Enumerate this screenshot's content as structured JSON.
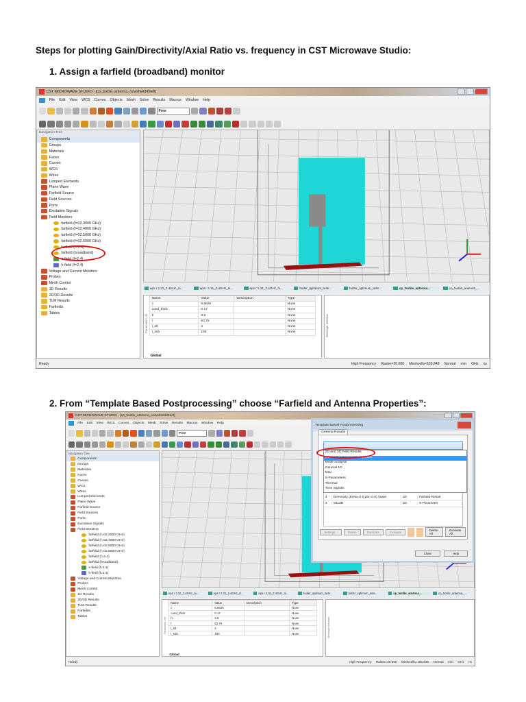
{
  "document": {
    "heading": "Steps for plotting Gain/Directivity/Axial Ratio vs. frequency in CST Microwave Studio:",
    "step1": "1.   Assign a farfield (broadband) monitor",
    "step2": "2.   From “Template Based Postprocessing” choose “Farfield and Antenna Properties”:"
  },
  "app": {
    "title": "CST MICROWAVE STUDIO - [cp_textile_antenna_newshield45left]",
    "menu": [
      "File",
      "Edit",
      "View",
      "WCS",
      "Curves",
      "Objects",
      "Mesh",
      "Solve",
      "Results",
      "Macros",
      "Window",
      "Help"
    ],
    "toolbar_select": "Free",
    "nav_title": "Navigation Tree",
    "nav": [
      {
        "label": "Components",
        "lvl": 0,
        "ic": "folder"
      },
      {
        "label": "Groups",
        "lvl": 0,
        "ic": "folder"
      },
      {
        "label": "Materials",
        "lvl": 0,
        "ic": "folder"
      },
      {
        "label": "Faces",
        "lvl": 0,
        "ic": "folder"
      },
      {
        "label": "Curves",
        "lvl": 0,
        "ic": "folder"
      },
      {
        "label": "WCS",
        "lvl": 0,
        "ic": "folder"
      },
      {
        "label": "Wires",
        "lvl": 0,
        "ic": "folder"
      },
      {
        "label": "Lumped Elements",
        "lvl": 0,
        "ic": "red"
      },
      {
        "label": "Plane Wave",
        "lvl": 0,
        "ic": "red"
      },
      {
        "label": "Farfield Source",
        "lvl": 0,
        "ic": "red"
      },
      {
        "label": "Field Sources",
        "lvl": 0,
        "ic": "red"
      },
      {
        "label": "Ports",
        "lvl": 0,
        "ic": "red"
      },
      {
        "label": "Excitation Signals",
        "lvl": 0,
        "ic": "red"
      },
      {
        "label": "Field Monitors",
        "lvl": 0,
        "ic": "red"
      },
      {
        "label": "farfield (f=02.3000 GHz)",
        "lvl": 1,
        "ic": "ff"
      },
      {
        "label": "farfield (f=02.4000 GHz)",
        "lvl": 1,
        "ic": "ff"
      },
      {
        "label": "farfield (f=02.5000 GHz)",
        "lvl": 1,
        "ic": "ff"
      },
      {
        "label": "farfield (f=02.6000 GHz)",
        "lvl": 1,
        "ic": "ff"
      },
      {
        "label": "farfield (f=2.4)",
        "lvl": 1,
        "ic": "ff"
      },
      {
        "label": "farfield (broadband)",
        "lvl": 1,
        "ic": "ff"
      },
      {
        "label": "e-field (f=2.4)",
        "lvl": 1,
        "ic": "ef"
      },
      {
        "label": "h-field (f=2.4)",
        "lvl": 1,
        "ic": "hf"
      },
      {
        "label": "Voltage and Current Monitors",
        "lvl": 0,
        "ic": "red"
      },
      {
        "label": "Probes",
        "lvl": 0,
        "ic": "red"
      },
      {
        "label": "Mesh Control",
        "lvl": 0,
        "ic": "red"
      },
      {
        "label": "1D Results",
        "lvl": 0,
        "ic": "folder"
      },
      {
        "label": "2D/3D Results",
        "lvl": 0,
        "ic": "folder"
      },
      {
        "label": "TLM Results",
        "lvl": 0,
        "ic": "folder"
      },
      {
        "label": "Farfields",
        "lvl": 0,
        "ic": "folder"
      },
      {
        "label": "Tables",
        "lvl": 0,
        "ic": "folder"
      }
    ],
    "tabs": [
      "eps r 2.31_2.4GHz_ni...",
      "eps r 2.31_2.4GHz_ni...",
      "eps r 2.31_2.4GHz_ni...",
      "butler_optimum_ante...",
      "butler_optimum_ante...",
      "cp_textile_antenna...",
      "cp_textile_antenna_..."
    ],
    "active_tab": 5,
    "params_headers": [
      "Name",
      "Value",
      "Description",
      "Type"
    ],
    "params": [
      [
        "c",
        "6.5625",
        "",
        "None"
      ],
      [
        "cond_thick",
        "0.17",
        "",
        "None"
      ],
      [
        "h",
        "3.5",
        "",
        "None"
      ],
      [
        "l",
        "53.75",
        "",
        "None"
      ],
      [
        "l_slt",
        "4",
        "",
        "None"
      ],
      [
        "l_sub",
        "150",
        "",
        "None"
      ]
    ],
    "params_label": "Parameter List",
    "global_tab": "Global",
    "message_label": "Message Window",
    "status_left": "Ready",
    "status_right": [
      "High Frequency",
      "Raster=20.000",
      "Meshcells=155,848",
      "Normal",
      "mm",
      "GHz",
      "ns"
    ]
  },
  "dialog": {
    "title": "Template Based Postprocessing",
    "tab": "General Results",
    "options": [
      "2D and 3D Field Results",
      "Farfield and Antenna Properties",
      "Mode Analysis",
      "General 1D",
      "Misc",
      "S-Parameters",
      "Thermal",
      "Time Signals"
    ],
    "selected": 1,
    "rows": [
      [
        "3",
        "Directivity (theta=0.0,phi=0.0).Value",
        "1D",
        "Farfield Result"
      ],
      [
        "4",
        "S11dB",
        "1D",
        "S-Parameter"
      ]
    ],
    "buttons": [
      "Settings...",
      "Delete",
      "Duplicate",
      "Evaluate",
      "Delete All",
      "Evaluate All"
    ],
    "close": "Close",
    "help": "Help"
  },
  "colors": {
    "antenna": "#1fd6d6",
    "ground": "#9a1010",
    "highlight": "#e01010"
  }
}
